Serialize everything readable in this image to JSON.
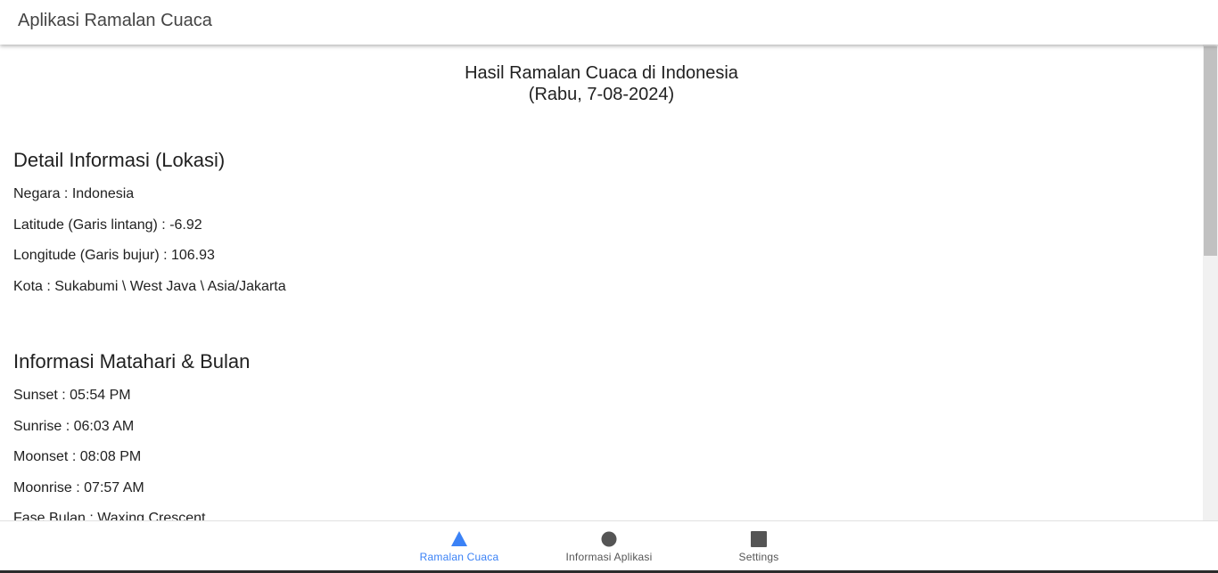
{
  "appbar": {
    "title": "Aplikasi Ramalan Cuaca"
  },
  "main": {
    "heading_line1": "Hasil Ramalan Cuaca di Indonesia",
    "heading_line2": "(Rabu, 7-08-2024)"
  },
  "location": {
    "title": "Detail Informasi (Lokasi)",
    "rows": [
      "Negara : Indonesia",
      "Latitude (Garis lintang) : -6.92",
      "Longitude (Garis bujur) : 106.93",
      "Kota : Sukabumi \\ West Java \\ Asia/Jakarta"
    ]
  },
  "astro": {
    "title": "Informasi Matahari & Bulan",
    "rows": [
      "Sunset : 05:54 PM",
      "Sunrise : 06:03 AM",
      "Moonset : 08:08 PM",
      "Moonrise : 07:57 AM",
      "Fase Bulan : Waxing Crescent"
    ]
  },
  "bottom_nav": {
    "items": [
      {
        "label": "Ramalan Cuaca",
        "icon": "triangle-icon",
        "active": true
      },
      {
        "label": "Informasi Aplikasi",
        "icon": "circle-icon",
        "active": false
      },
      {
        "label": "Settings",
        "icon": "square-icon",
        "active": false
      }
    ]
  },
  "colors": {
    "accent": "#3b82f6",
    "icon_inactive": "#555555",
    "text": "#212121"
  }
}
